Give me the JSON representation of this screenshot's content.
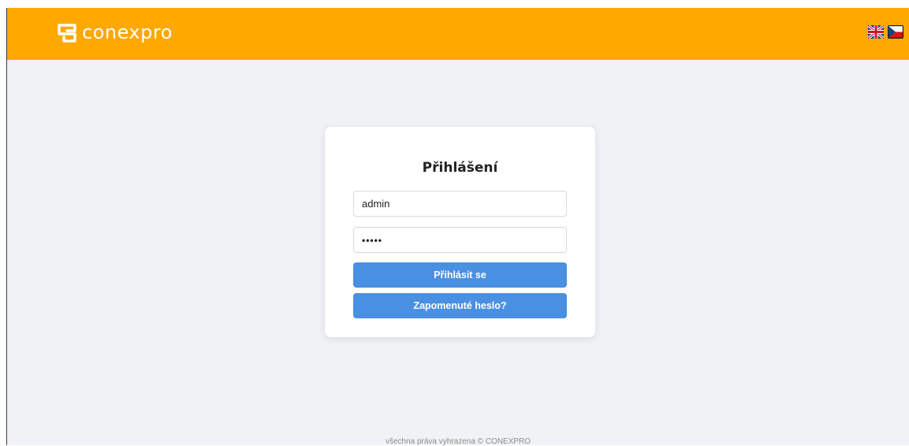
{
  "header": {
    "brand": "conexpro",
    "background_color": "#fea800",
    "languages": [
      {
        "code": "en",
        "icon": "uk-flag-icon"
      },
      {
        "code": "cs",
        "icon": "cz-flag-icon"
      }
    ]
  },
  "login": {
    "title": "Přihlášení",
    "username_value": "admin",
    "password_value": "•••••",
    "login_button": "Přihlásit se",
    "forgot_button": "Zapomenuté heslo?",
    "button_color": "#4a90e2"
  },
  "footer": {
    "text": "všechna práva vyhrazena © CONEXPRO"
  }
}
